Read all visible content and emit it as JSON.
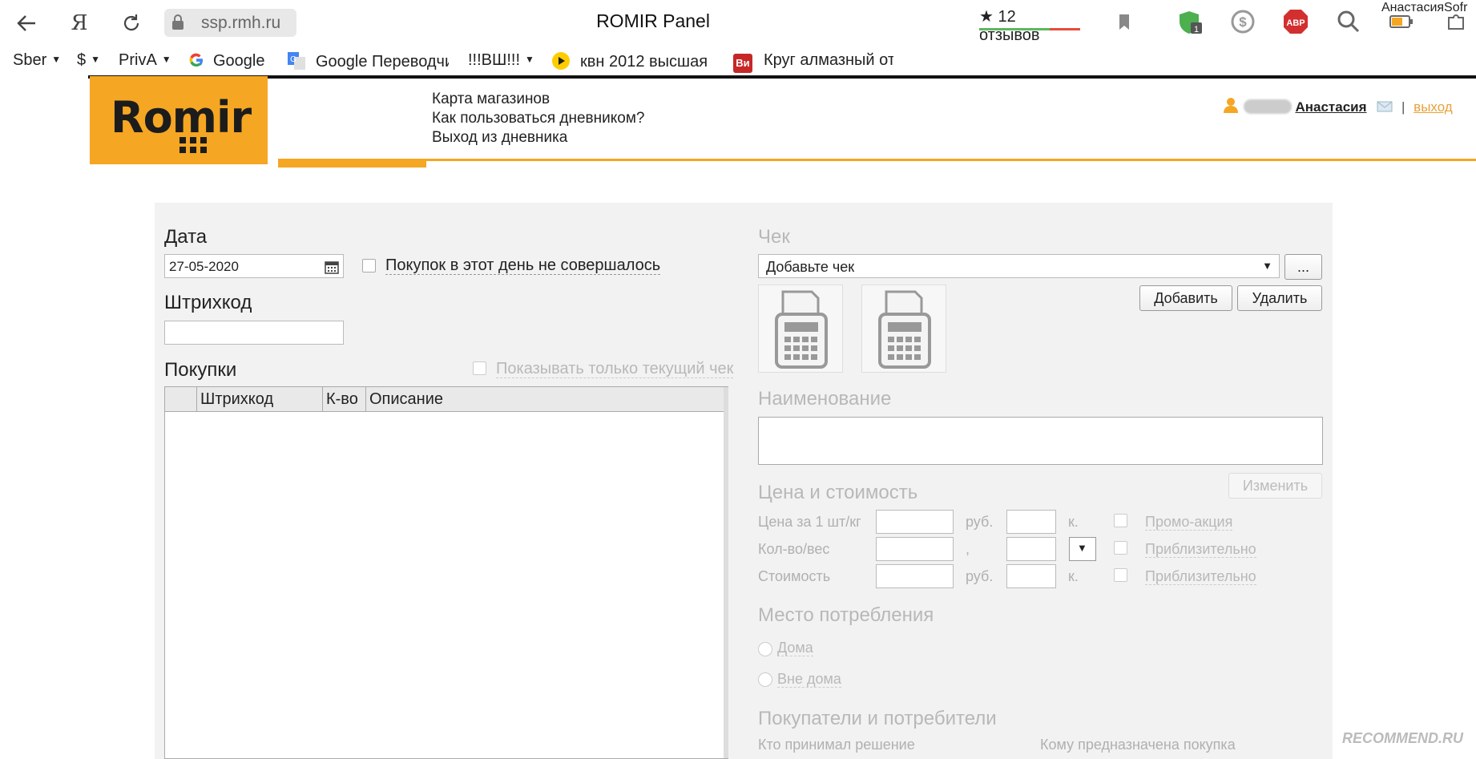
{
  "browser": {
    "url": "ssp.rmh.ru",
    "title": "ROMIR Panel",
    "yandex_glyph": "Я",
    "reviews": "★ 12 отзывов",
    "account_name": "АнастасияSofr",
    "extensions": [
      "shield-badge-1",
      "dollar-icon",
      "abp-icon",
      "magnifier-icon",
      "battery-icon",
      "puzzle-icon"
    ],
    "abp_label": "ABP",
    "shield_badge": "1"
  },
  "bookmarks": [
    {
      "label": "Sber",
      "dropdown": true
    },
    {
      "label": "$",
      "dropdown": true
    },
    {
      "label": "PrivA",
      "dropdown": true
    },
    {
      "label": "Google",
      "icon": "google-icon"
    },
    {
      "label": "Google Переводчи",
      "icon": "translate-icon"
    },
    {
      "label": "!!!ВШ!!!",
      "dropdown": true
    },
    {
      "label": "квн 2012 высшая",
      "icon": "play-icon"
    },
    {
      "label": "Круг алмазный отр",
      "icon": "vi-icon",
      "icon_text": "Ви"
    }
  ],
  "header": {
    "logo_text": "Romir",
    "links": [
      "Карта магазинов",
      "Как пользоваться дневником?",
      "Выход из дневника"
    ],
    "user_name": "Анастасия",
    "separator": "|",
    "logout": "выход"
  },
  "form": {
    "date_label": "Дата",
    "date_value": "27-05-2020",
    "no_purchases_label": "Покупок в этот день не совершалось",
    "barcode_label": "Штрихкод",
    "barcode_value": "",
    "purchases_label": "Покупки",
    "show_current_label": "Показывать только текущий чек",
    "table_columns": [
      "",
      "Штрихкод",
      "К-во",
      "Описание"
    ],
    "receipt_label": "Чек",
    "receipt_select": "Добавьте чек",
    "receipt_more": "...",
    "add_button": "Добавить",
    "delete_button": "Удалить",
    "name_label": "Наименование",
    "change_button": "Изменить",
    "price_section": "Цена и стоимость",
    "price_rows": [
      {
        "label": "Цена за 1 шт/кг",
        "unit": "руб.",
        "sub_unit": "к.",
        "check_label": "Промо-акция"
      },
      {
        "label": "Кол-во/вес",
        "unit": ",",
        "sub_unit": "▼",
        "check_label": "Приблизительно"
      },
      {
        "label": "Стоимость",
        "unit": "руб.",
        "sub_unit": "к.",
        "check_label": "Приблизительно"
      }
    ],
    "place_label": "Место потребления",
    "place_options": [
      "Дома",
      "Вне дома"
    ],
    "buyers_label": "Покупатели и потребители",
    "decision_label": "Кто принимал решение",
    "for_whom_label": "Кому предназначена покупка"
  },
  "watermark": "RECOMMEND.RU",
  "colors": {
    "brand": "#f5a623",
    "link": "#e8a23a"
  }
}
